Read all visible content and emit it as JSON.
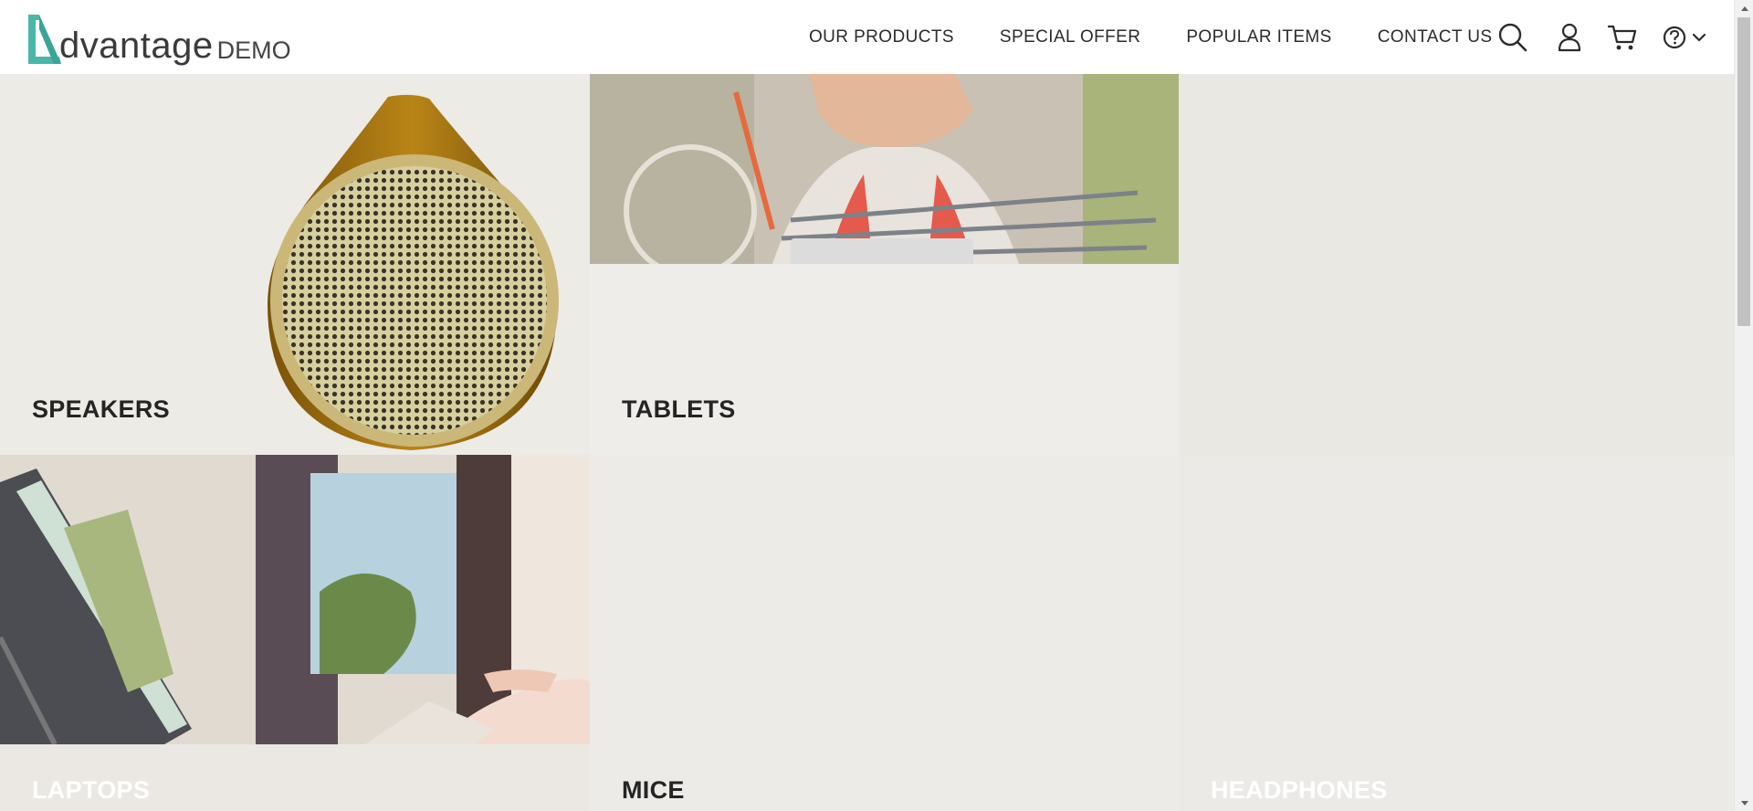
{
  "brand": {
    "name": "dvantage",
    "suffix": "DEMO",
    "accent_color": "#4ab6a8"
  },
  "nav": {
    "items": [
      {
        "label": "OUR PRODUCTS"
      },
      {
        "label": "SPECIAL OFFER"
      },
      {
        "label": "POPULAR ITEMS"
      },
      {
        "label": "CONTACT US"
      }
    ]
  },
  "header_icons": {
    "search": "search-icon",
    "user": "user-icon",
    "cart": "cart-icon",
    "help": "help-icon",
    "dropdown": "chevron-down-icon"
  },
  "categories": [
    {
      "label": "SPEAKERS",
      "label_color": "#242424"
    },
    {
      "label": "TABLETS",
      "label_color": "#242424"
    },
    {
      "label": "LAPTOPS",
      "label_color": "#ffffff"
    },
    {
      "label": "MICE",
      "label_color": "#242424"
    },
    {
      "label": "HEADPHONES",
      "label_color": "#ffffff"
    }
  ]
}
